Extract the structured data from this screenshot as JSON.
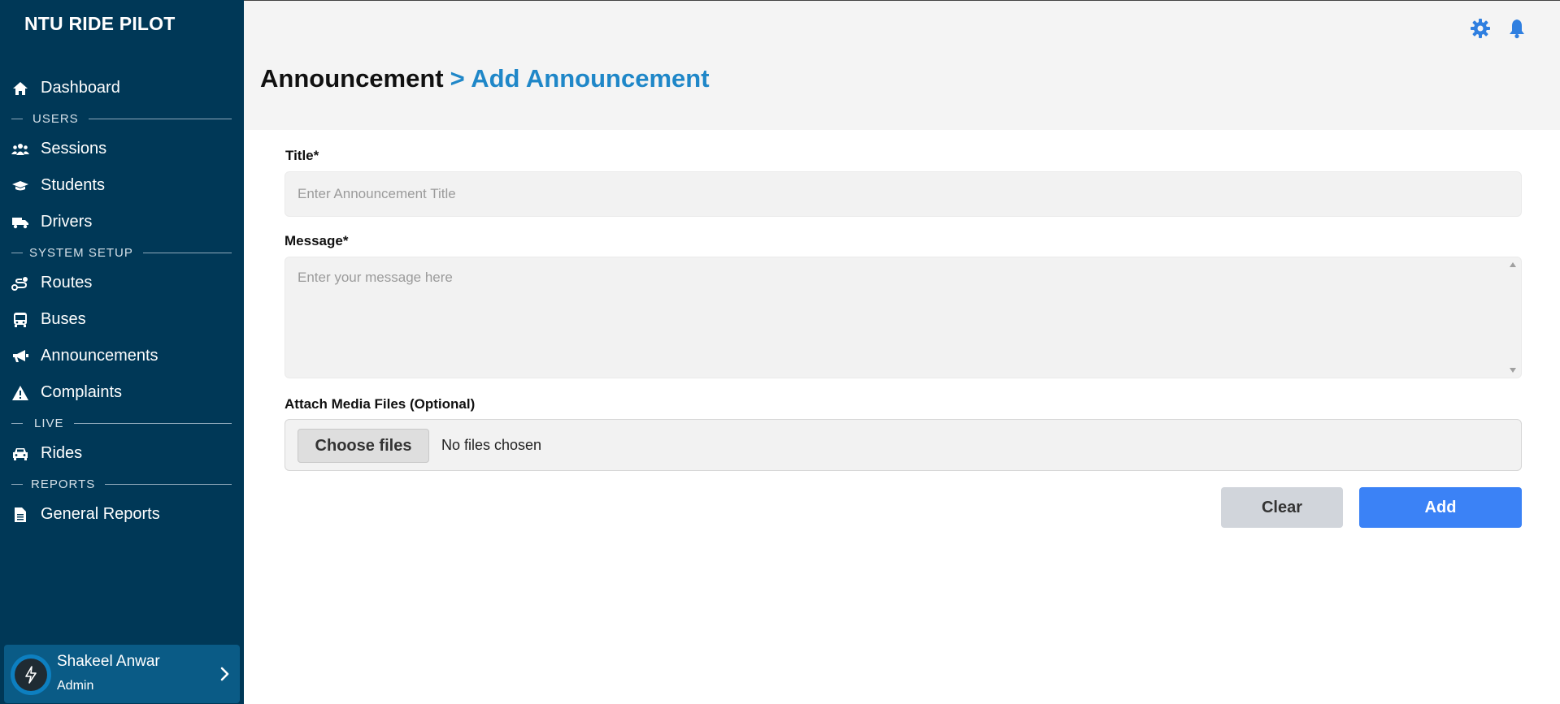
{
  "app": {
    "brand": "NTU RIDE PILOT"
  },
  "sidebar": {
    "dashboard": "Dashboard",
    "sections": {
      "users": "USERS",
      "system_setup": "SYSTEM SETUP",
      "live": "LIVE",
      "reports": "REPORTS"
    },
    "items": {
      "sessions": "Sessions",
      "students": "Students",
      "drivers": "Drivers",
      "routes": "Routes",
      "buses": "Buses",
      "announcements": "Announcements",
      "complaints": "Complaints",
      "rides": "Rides",
      "general_reports": "General Reports"
    },
    "user": {
      "name": "Shakeel Anwar",
      "role": "Admin"
    }
  },
  "header": {
    "breadcrumb_parent": "Announcement",
    "breadcrumb_current": "> Add Announcement",
    "icons": [
      "gear-icon",
      "bell-icon"
    ],
    "accent_color": "#1f87c8"
  },
  "form": {
    "title_label": "Title*",
    "title_placeholder": "Enter Announcement Title",
    "message_label": "Message*",
    "message_placeholder": "Enter your message here",
    "media_label": "Attach Media Files (Optional)",
    "choose_files_label": "Choose files",
    "no_files_text": "No files chosen",
    "clear_label": "Clear",
    "add_label": "Add"
  },
  "colors": {
    "sidebar_bg": "#003857",
    "primary_button": "#3b82f6",
    "secondary_button": "#d1d5db"
  }
}
